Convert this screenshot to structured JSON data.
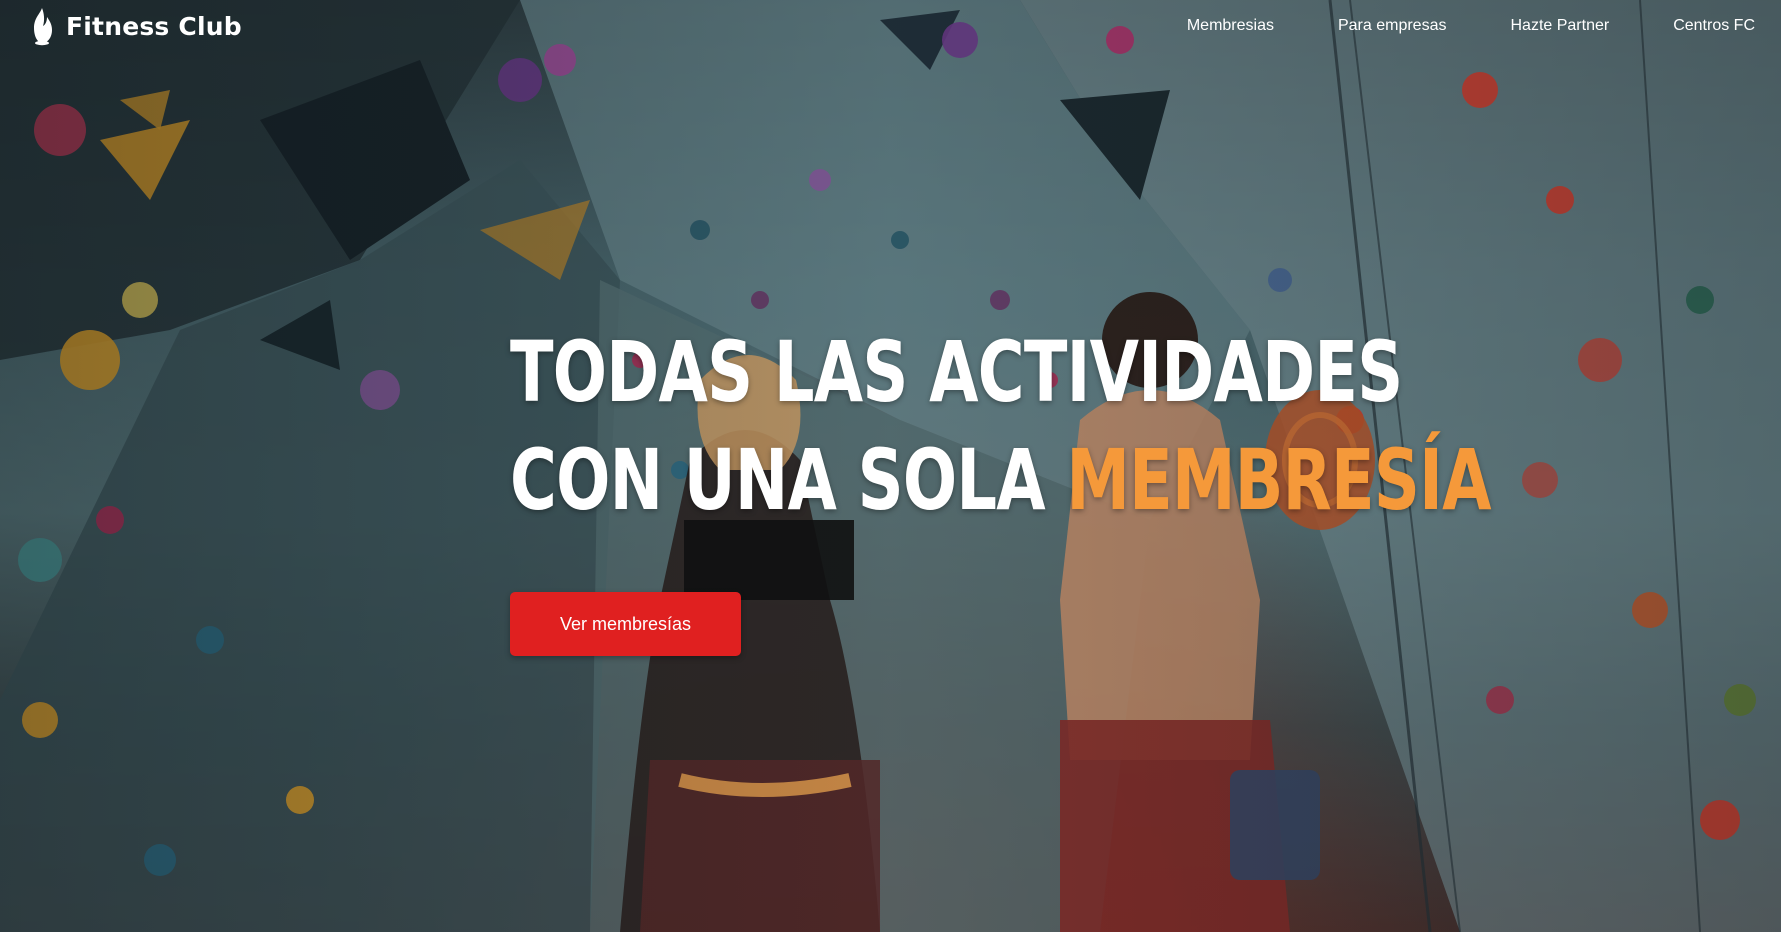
{
  "brand": {
    "name": "Fitness Club",
    "logo_icon": "flame-icon"
  },
  "nav": {
    "items": [
      {
        "label": "Membresias"
      },
      {
        "label": "Para empresas"
      },
      {
        "label": "Hazte Partner"
      },
      {
        "label": "Centros FC"
      }
    ]
  },
  "hero": {
    "headline_line1": "TODAS LAS ACTIVIDADES",
    "headline_line2_prefix": "CON UNA SOLA ",
    "headline_line2_accent": "MEMBRESÍA",
    "cta_label": "Ver membresías"
  },
  "colors": {
    "accent": "#f5993a",
    "cta": "#e02020",
    "text": "#ffffff"
  }
}
